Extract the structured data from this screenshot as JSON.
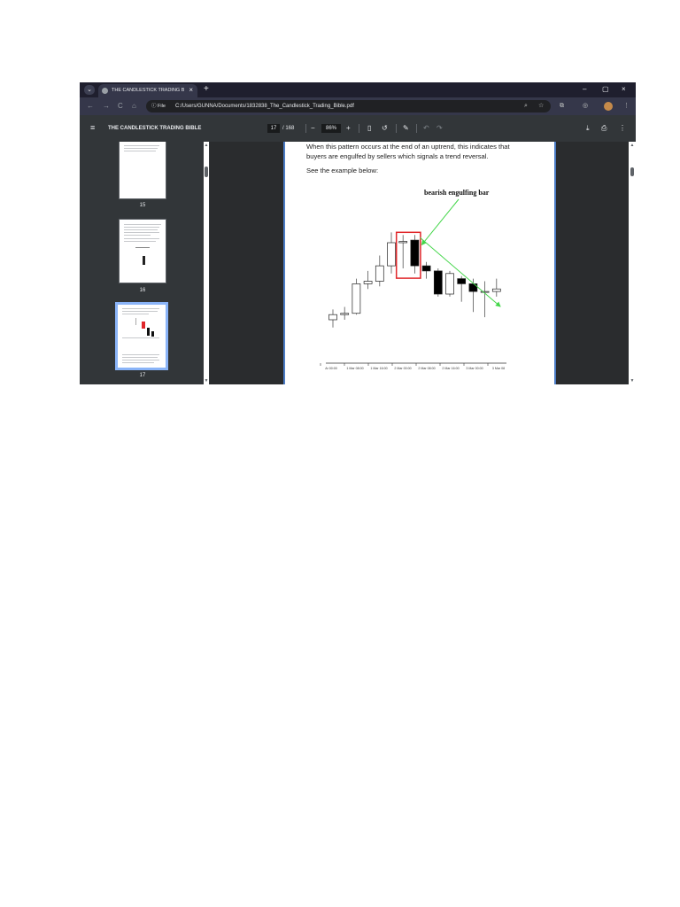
{
  "browser": {
    "tab_title": "THE CANDLESTICK TRADING BI",
    "tab_close": "×",
    "new_tab": "+",
    "tab_menu": "⌄",
    "window_controls": {
      "minimize": "–",
      "maximize": "▢",
      "close": "×"
    },
    "nav": {
      "back": "←",
      "forward": "→",
      "reload": "C",
      "home": "⌂"
    },
    "file_chip": "ⓘ File",
    "url": "C:/Users/GUNNA/Documents/1832838_The_Candlestick_Trading_Bible.pdf",
    "icons": [
      "zoom-icon",
      "star-icon",
      "extensions-icon",
      "profile-switch-icon",
      "avatar",
      "kebab-menu-icon"
    ]
  },
  "pdf_toolbar": {
    "menu_icon": "≡",
    "title": "THE CANDLESTICK TRADING BIBLE",
    "page_current": "17",
    "page_total": "/ 168",
    "zoom_out": "−",
    "zoom_value": "86%",
    "zoom_in": "+",
    "download_icon": "⤓",
    "print_icon": "⎙",
    "more_icon": "⋮"
  },
  "sidebar": {
    "thumbnails": [
      {
        "label": "15",
        "selected": false
      },
      {
        "label": "16",
        "selected": false
      },
      {
        "label": "17",
        "selected": true
      }
    ]
  },
  "page": {
    "paragraph_line1": "When this pattern occurs at the end of an uptrend, this indicates that",
    "paragraph_line2": "buyers are engulfed by sellers which signals a trend reversal.",
    "see_example": "See the example below:",
    "chart_annotation": "bearish engulfing bar"
  },
  "chart_data": {
    "type": "candlestick",
    "annotation": "bearish engulfing bar",
    "x_tick_labels": [
      "Ar 00:00",
      "1 Mar 08:00",
      "1 Mar 16:00",
      "2 Mar 00:00",
      "2 Mar 08:00",
      "2 Mar 16:00",
      "3 Mar 00:00",
      "3 Mar 08"
    ],
    "candles": [
      {
        "open": 20,
        "close": 24,
        "high": 28,
        "low": 14,
        "bullish": true
      },
      {
        "open": 24,
        "close": 25,
        "high": 30,
        "low": 20,
        "bullish": true
      },
      {
        "open": 25,
        "close": 48,
        "high": 52,
        "low": 24,
        "bullish": true
      },
      {
        "open": 48,
        "close": 50,
        "high": 58,
        "low": 44,
        "bullish": true
      },
      {
        "open": 50,
        "close": 62,
        "high": 70,
        "low": 46,
        "bullish": true
      },
      {
        "open": 62,
        "close": 80,
        "high": 88,
        "low": 56,
        "bullish": true
      },
      {
        "open": 80,
        "close": 81,
        "high": 86,
        "low": 60,
        "bullish": true
      },
      {
        "open": 82,
        "close": 62,
        "high": 86,
        "low": 56,
        "bullish": false
      },
      {
        "open": 62,
        "close": 58,
        "high": 65,
        "low": 52,
        "bullish": false
      },
      {
        "open": 58,
        "close": 40,
        "high": 60,
        "low": 38,
        "bullish": false
      },
      {
        "open": 40,
        "close": 56,
        "high": 58,
        "low": 38,
        "bullish": true
      },
      {
        "open": 52,
        "close": 48,
        "high": 54,
        "low": 34,
        "bullish": false
      },
      {
        "open": 48,
        "close": 42,
        "high": 52,
        "low": 26,
        "bullish": false
      },
      {
        "open": 42,
        "close": 42,
        "high": 50,
        "low": 22,
        "bullish": true
      },
      {
        "open": 42,
        "close": 44,
        "high": 52,
        "low": 38,
        "bullish": true
      }
    ],
    "highlight_candles": [
      6,
      7
    ],
    "colors": {
      "highlight_box": "#e0262a",
      "arrow": "#44d64a",
      "bearish": "#000000",
      "bullish": "#ffffff"
    }
  }
}
